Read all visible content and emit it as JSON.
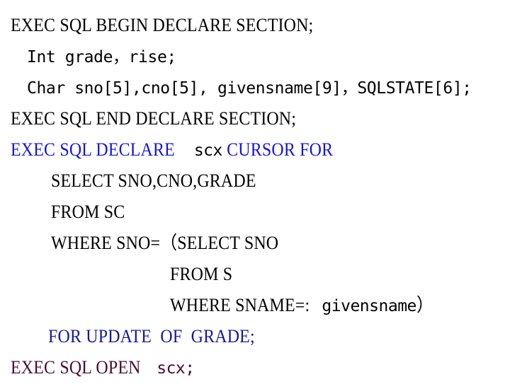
{
  "slide": {
    "background_color": "#ffffff",
    "colors": {
      "default_text": "#000000",
      "cursor_declare_blue": "#1414dc",
      "for_update_navy": "#16169c",
      "open_statement_maroon": "#4a0a32"
    }
  },
  "code": {
    "language": "Embedded SQL (ESQL/C)",
    "lines": [
      {
        "indent": "ind0",
        "color": "#000000",
        "text": "EXEC SQL BEGIN DECLARE SECTION;",
        "segments": [
          {
            "style": "up",
            "color": "#000000",
            "text": "EXEC SQL BEGIN DECLARE SECTION;"
          }
        ]
      },
      {
        "indent": "ind1",
        "color": "#000000",
        "text": "Int grade，rise;",
        "segments": [
          {
            "style": "mixed",
            "color": "#000000",
            "text": "Int grade，rise;"
          }
        ]
      },
      {
        "indent": "ind1",
        "color": "#000000",
        "text": "Char sno[5],cno[5], givensname[9]，SQLSTATE[6];",
        "segments": [
          {
            "style": "mixed",
            "color": "#000000",
            "text": "Char sno[5],cno[5], givensname[9]，SQLSTATE[6];"
          }
        ]
      },
      {
        "indent": "ind0",
        "color": "#000000",
        "text": "EXEC SQL END DECLARE SECTION;",
        "segments": [
          {
            "style": "up",
            "color": "#000000",
            "text": "EXEC SQL END DECLARE SECTION;"
          }
        ]
      },
      {
        "indent": "ind0",
        "color": "#1414dc",
        "text": "EXEC SQL DECLARE scx CURSOR FOR",
        "segments": [
          {
            "style": "up",
            "color": "#1414dc",
            "text": "EXEC SQL DECLARE "
          },
          {
            "style": "lo",
            "color": "#000000",
            "text": "scx"
          },
          {
            "style": "up",
            "color": "#1414dc",
            "text": " CURSOR FOR"
          }
        ]
      },
      {
        "indent": "ind2",
        "color": "#000000",
        "text": "SELECT SNO,CNO,GRADE",
        "segments": [
          {
            "style": "up",
            "color": "#000000",
            "text": "SELECT SNO,CNO,GRADE"
          }
        ]
      },
      {
        "indent": "ind2",
        "color": "#000000",
        "text": "FROM SC",
        "segments": [
          {
            "style": "up",
            "color": "#000000",
            "text": "FROM SC"
          }
        ]
      },
      {
        "indent": "ind2",
        "color": "#000000",
        "text": "WHERE SNO=（SELECT SNO",
        "segments": [
          {
            "style": "up",
            "color": "#000000",
            "text": "WHERE SNO=（SELECT SNO"
          }
        ]
      },
      {
        "indent": "ind3",
        "color": "#000000",
        "text": "FROM S",
        "segments": [
          {
            "style": "up",
            "color": "#000000",
            "text": "FROM S"
          }
        ]
      },
      {
        "indent": "ind3",
        "color": "#000000",
        "text": "WHERE SNAME=:givensname）",
        "segments": [
          {
            "style": "up",
            "color": "#000000",
            "text": "WHERE SNAME=:"
          },
          {
            "style": "lo",
            "color": "#000000",
            "text": "givensname"
          },
          {
            "style": "up",
            "color": "#000000",
            "text": "）"
          }
        ]
      },
      {
        "indent": "ind4",
        "color": "#16169c",
        "text": "FOR UPDATE  OF  GRADE;",
        "segments": [
          {
            "style": "up",
            "color": "#16169c",
            "text": "FOR UPDATE  OF  GRADE;"
          }
        ]
      },
      {
        "indent": "ind0",
        "color": "#4a0a32",
        "text": "EXEC SQL OPEN scx;",
        "segments": [
          {
            "style": "up",
            "color": "#4a0a32",
            "text": "EXEC SQL OPEN "
          },
          {
            "style": "lo",
            "color": "#4a0a32",
            "text": "scx;"
          }
        ]
      }
    ]
  }
}
